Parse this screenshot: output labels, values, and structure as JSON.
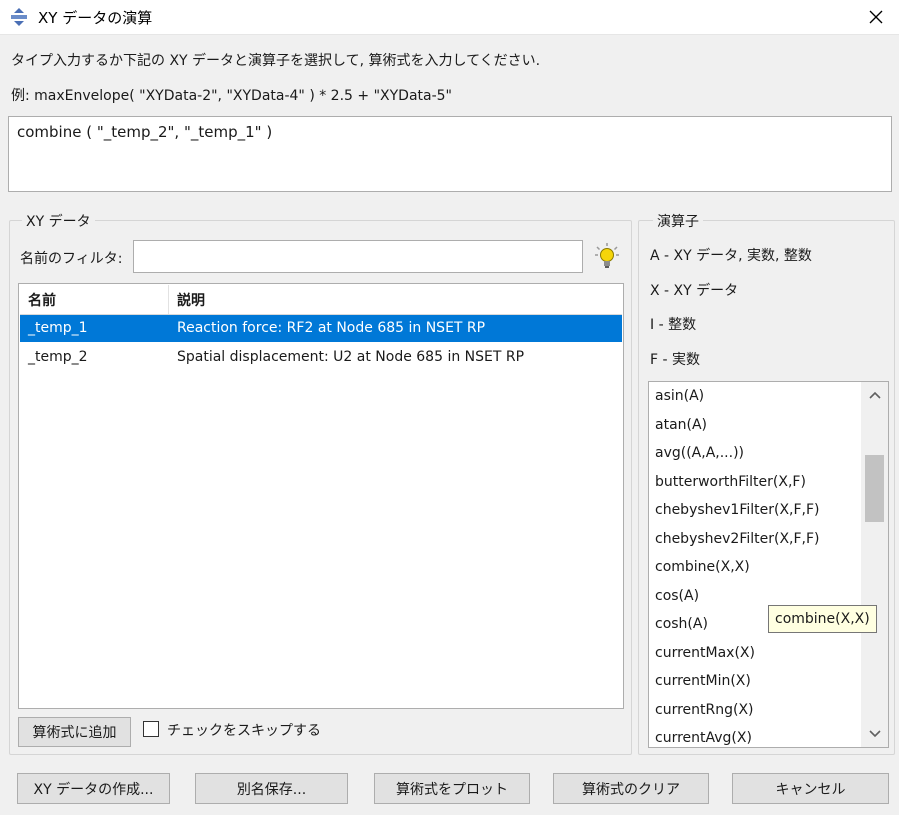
{
  "window": {
    "title": "XY データの演算",
    "close_icon": "close-icon",
    "app_icon": "abaqus-app-icon"
  },
  "instruction": "タイプ入力するか下記の XY データと演算子を選択して, 算術式を入力してください.",
  "example": "例: maxEnvelope( \"XYData-2\", \"XYData-4\" ) * 2.5 + \"XYData-5\"",
  "expression": "combine ( \"_temp_2\", \"_temp_1\" )",
  "xy_data": {
    "legend": "XY データ",
    "filter_label": "名前のフィルタ:",
    "filter_value": "",
    "filter_icon": "lightbulb-icon",
    "columns": [
      "名前",
      "説明"
    ],
    "rows": [
      {
        "name": "_temp_1",
        "description": "Reaction force: RF2 at Node 685 in NSET RP",
        "selected": true
      },
      {
        "name": "_temp_2",
        "description": "Spatial displacement: U2 at Node 685 in NSET RP",
        "selected": false
      }
    ],
    "add_button": "算術式に追加",
    "skip_check_label": "チェックをスキップする",
    "skip_check_checked": false
  },
  "operators": {
    "legend": "演算子",
    "legend_lines": [
      "A - XY データ, 実数, 整数",
      "X - XY データ",
      "I - 整数",
      "F - 実数"
    ],
    "items": [
      "asin(A)",
      "atan(A)",
      "avg((A,A,...))",
      "butterworthFilter(X,F)",
      "chebyshev1Filter(X,F,F)",
      "chebyshev2Filter(X,F,F)",
      "combine(X,X)",
      "cos(A)",
      "cosh(A)",
      "currentMax(X)",
      "currentMin(X)",
      "currentRng(X)",
      "currentAvg(X)"
    ],
    "tooltip": "combine(X,X)"
  },
  "buttons": {
    "create": "XY データの作成...",
    "save_as": "別名保存...",
    "plot": "算術式をプロット",
    "clear": "算術式のクリア",
    "cancel": "キャンセル"
  },
  "colors": {
    "selection": "#0078d7",
    "tooltip_bg": "#ffffe1",
    "bulb": "#f5d50a"
  }
}
